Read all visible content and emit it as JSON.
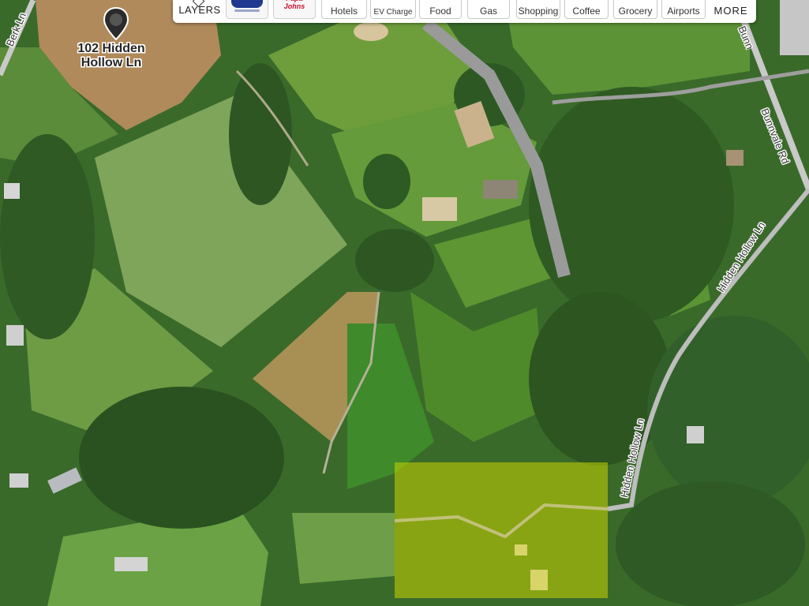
{
  "toolbar": {
    "layers_label": "LAYERS",
    "brand1_name": "",
    "brand2_name": "Papa Johns",
    "categories": [
      "Hotels",
      "EV Charge",
      "Food",
      "Gas",
      "Shopping",
      "Coffee",
      "Grocery",
      "Airports"
    ],
    "more_label": "MORE"
  },
  "marker": {
    "address_line1": "102 Hidden",
    "address_line2": "Hollow Ln"
  },
  "roads": {
    "berk": "Berk Ln",
    "bunnvale_top": "Bunnvale Rd",
    "bunnvale": "Bunnvale Rd",
    "hidden_hollow_1": "Hidden Hollow Ln",
    "hidden_hollow_2": "Hidden Hollow Ln"
  },
  "colors": {
    "highlight_parcel": "#c8d400",
    "pin": "#2b2b2b",
    "road": "#c9c9c9"
  }
}
